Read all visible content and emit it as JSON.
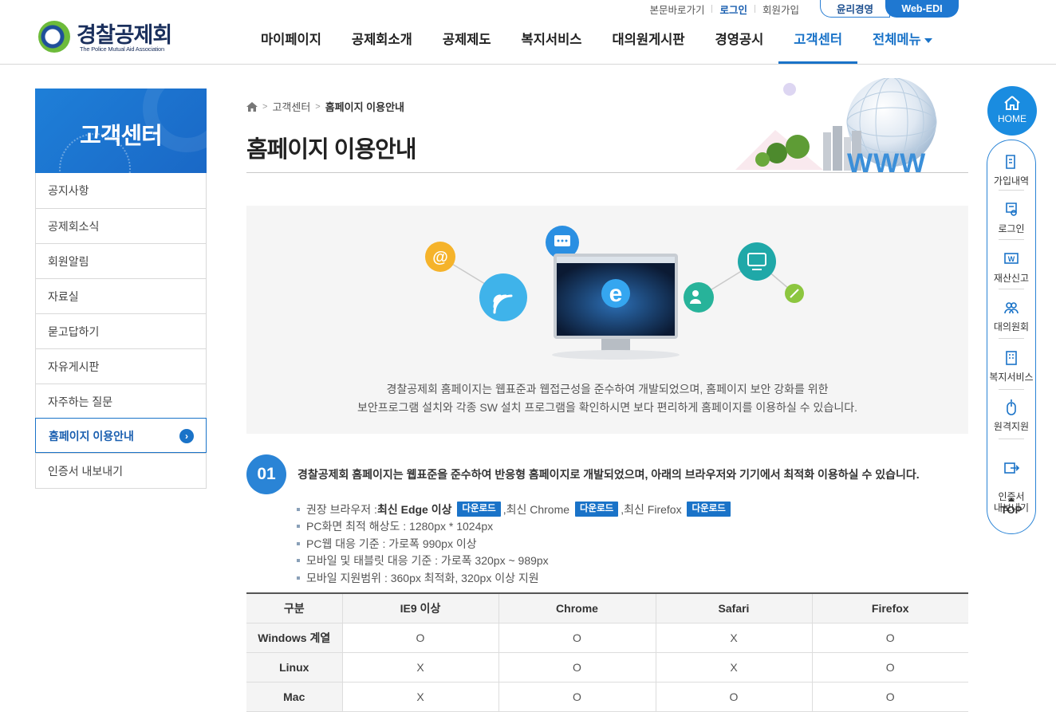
{
  "util": {
    "skip": "본문바로가기",
    "login": "로그인",
    "join": "회원가입",
    "ethics": "윤리경영",
    "edi": "Web-EDI"
  },
  "logo": {
    "kr": "경찰공제회",
    "en": "The Police Mutual Aid Association"
  },
  "gnb": {
    "items": [
      "마이페이지",
      "공제회소개",
      "공제제도",
      "복지서비스",
      "대의원게시판",
      "경영공시",
      "고객센터"
    ],
    "all": "전체메뉴"
  },
  "lnb": {
    "title": "고객센터",
    "items": [
      "공지사항",
      "공제회소식",
      "회원알림",
      "자료실",
      "묻고답하기",
      "자유게시판",
      "자주하는 질문",
      "홈페이지 이용안내",
      "인증서 내보내기"
    ]
  },
  "breadcrumb": {
    "level1": "고객센터",
    "current": "홈페이지 이용안내"
  },
  "page_title": "홈페이지 이용안내",
  "intro": {
    "line1": "경찰공제회 홈페이지는  웹표준과 웹접근성을 준수하여 개발되었으며, 홈페이지 보안 강화를 위한",
    "line2": "보안프로그램 설치와 각종 SW 설치 프로그램을 확인하시면 보다 편리하게 홈페이지를 이용하실 수 있습니다."
  },
  "step1": {
    "num": "01",
    "text": "경찰공제회 홈페이지는 웹표준을 준수하여 반응형 홈페이지로 개발되었으며, 아래의 브라우저와 기기에서 최적화 이용하실 수 있습니다."
  },
  "specs": {
    "browser_prefix": "권장 브라우저 : ",
    "edge": "최신 Edge 이상",
    "chrome": "최신 Chrome",
    "firefox": "최신 Firefox",
    "download": "다운로드",
    "comma": ", ",
    "items": [
      "PC화면 최적 해상도 : 1280px * 1024px",
      "PC웹 대응 기준 : 가로폭 990px 이상",
      "모바일 및 태블릿 대응 기준 : 가로폭 320px ~ 989px",
      "모바일 지원범위 : 360px 최적화, 320px 이상 지원"
    ]
  },
  "table": {
    "headers": [
      "구분",
      "IE9 이상",
      "Chrome",
      "Safari",
      "Firefox"
    ],
    "rows": [
      [
        "Windows 계열",
        "O",
        "O",
        "X",
        "O"
      ],
      [
        "Linux",
        "X",
        "O",
        "X",
        "O"
      ],
      [
        "Mac",
        "X",
        "O",
        "O",
        "O"
      ]
    ]
  },
  "quick": {
    "home": "HOME",
    "items": [
      "가입내역",
      "로그인",
      "재산신고",
      "대의원회",
      "복지서비스",
      "원격지원",
      "인증서\n내보내기"
    ],
    "top": "TOP"
  },
  "colors": {
    "primary": "#1a73c8",
    "accent": "#2a84d6",
    "logo_navy": "#1a2f5c"
  }
}
